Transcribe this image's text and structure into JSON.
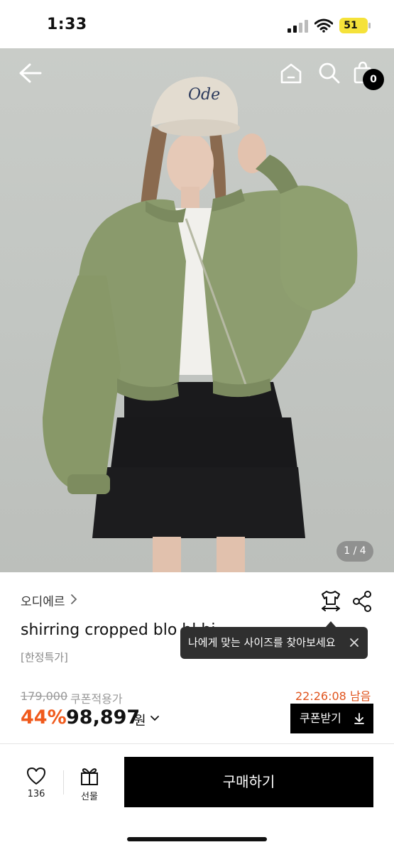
{
  "status_bar": {
    "time": "1:33",
    "battery": "51"
  },
  "header": {
    "cart_count": "0"
  },
  "gallery": {
    "pager": "1 / 4"
  },
  "product": {
    "brand": "오디에르",
    "title": "shirring cropped blo     bl  hi",
    "tag": "[한정특가]",
    "size_tooltip": "나에게 맞는 사이즈를 찾아보세요",
    "original_price": "179,000",
    "coupon_label": "쿠폰적용가",
    "timer": "22:26:08 남음",
    "discount": "44%",
    "price": "98,897",
    "currency": "원",
    "coupon_button": "쿠폰받기"
  },
  "bottom_bar": {
    "likes": "136",
    "gift_label": "선물",
    "buy_label": "구매하기"
  },
  "icons": [
    "back-arrow-icon",
    "home-icon",
    "search-icon",
    "shopping-bag-icon",
    "chevron-right-icon",
    "size-guide-icon",
    "share-icon",
    "close-icon",
    "chevron-down-icon",
    "download-icon",
    "heart-icon",
    "gift-icon"
  ],
  "colors": {
    "accent": "#f05a1c",
    "timer": "#e0531c",
    "primary_button": "#000000",
    "battery": "#f5e23a"
  }
}
